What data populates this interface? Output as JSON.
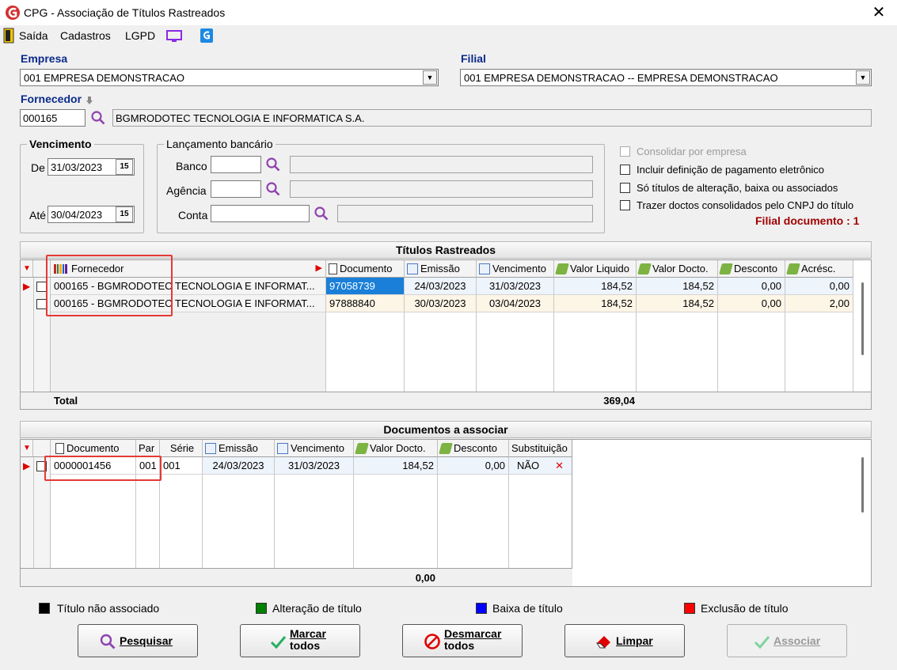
{
  "window": {
    "title": "CPG - Associação de Títulos Rastreados",
    "close_glyph": "✕"
  },
  "menu": {
    "items": [
      {
        "label": "Saída"
      },
      {
        "label": "Cadastros"
      },
      {
        "label": "LGPD"
      }
    ]
  },
  "empresa": {
    "label": "Empresa",
    "value": "001 EMPRESA DEMONSTRACAO"
  },
  "filial": {
    "label": "Filial",
    "value": "001 EMPRESA DEMONSTRACAO -- EMPRESA DEMONSTRACAO"
  },
  "fornecedor": {
    "label": "Fornecedor",
    "code": "000165",
    "name": "BGMRODOTEC TECNOLOGIA E INFORMATICA S.A."
  },
  "vencimento": {
    "title": "Vencimento",
    "de_label": "De",
    "de_value": "31/03/2023",
    "ate_label": "Até",
    "ate_value": "30/04/2023"
  },
  "lancamento": {
    "title": "Lançamento bancário",
    "banco_label": "Banco",
    "banco_value": "",
    "banco_desc": "",
    "agencia_label": "Agência",
    "agencia_value": "",
    "agencia_desc": "",
    "conta_label": "Conta",
    "conta_value": "",
    "conta_desc": ""
  },
  "options": [
    {
      "label": "Consolidar por empresa",
      "checked": false,
      "enabled": false
    },
    {
      "label": "Incluir definição de pagamento eletrônico",
      "checked": false,
      "enabled": true
    },
    {
      "label": "Só títulos de alteração, baixa ou associados",
      "checked": false,
      "enabled": true
    },
    {
      "label": "Trazer doctos consolidados pelo CNPJ do título",
      "checked": false,
      "enabled": true
    }
  ],
  "filial_documento": "Filial documento : 1",
  "titulos": {
    "title": "Títulos Rastreados",
    "headers": [
      "Fornecedor",
      "Documento",
      "Emissão",
      "Vencimento",
      "Valor Liquido",
      "Valor Docto.",
      "Desconto",
      "Acrésc."
    ],
    "rows": [
      [
        "000165 - BGMRODOTEC TECNOLOGIA E INFORMAT...",
        "97058739",
        "24/03/2023",
        "31/03/2023",
        "184,52",
        "184,52",
        "0,00",
        "0,00"
      ],
      [
        "000165 - BGMRODOTEC TECNOLOGIA E INFORMAT...",
        "97888840",
        "30/03/2023",
        "03/04/2023",
        "184,52",
        "184,52",
        "0,00",
        "2,00"
      ]
    ],
    "total_label": "Total",
    "total_value": "369,04"
  },
  "documentos": {
    "title": "Documentos a associar",
    "headers": [
      "Documento",
      "Par",
      "Série",
      "Emissão",
      "Vencimento",
      "Valor Docto.",
      "Desconto",
      "Substituição"
    ],
    "rows": [
      [
        "0000001456",
        "001",
        "001",
        "24/03/2023",
        "31/03/2023",
        "184,52",
        "0,00",
        "NÃO"
      ]
    ],
    "total_value": "0,00"
  },
  "legend": [
    {
      "label": "Título não associado",
      "color": "#000000"
    },
    {
      "label": "Alteração de título",
      "color": "#008000"
    },
    {
      "label": "Baixa de título",
      "color": "#0000ff"
    },
    {
      "label": "Exclusão de título",
      "color": "#ff0000"
    }
  ],
  "buttons": {
    "pesquisar": "Pesquisar",
    "marcar_1": "Marcar",
    "marcar_2": "todos",
    "desmarcar_1": "Desmarcar",
    "desmarcar_2": "todos",
    "limpar": "Limpar",
    "associar": "Associar"
  },
  "colors": {
    "label_blue": "#0a2a8a",
    "alert_red": "#a00000",
    "selection_blue": "#1a7fd8",
    "highlight_box": "#e53935"
  }
}
